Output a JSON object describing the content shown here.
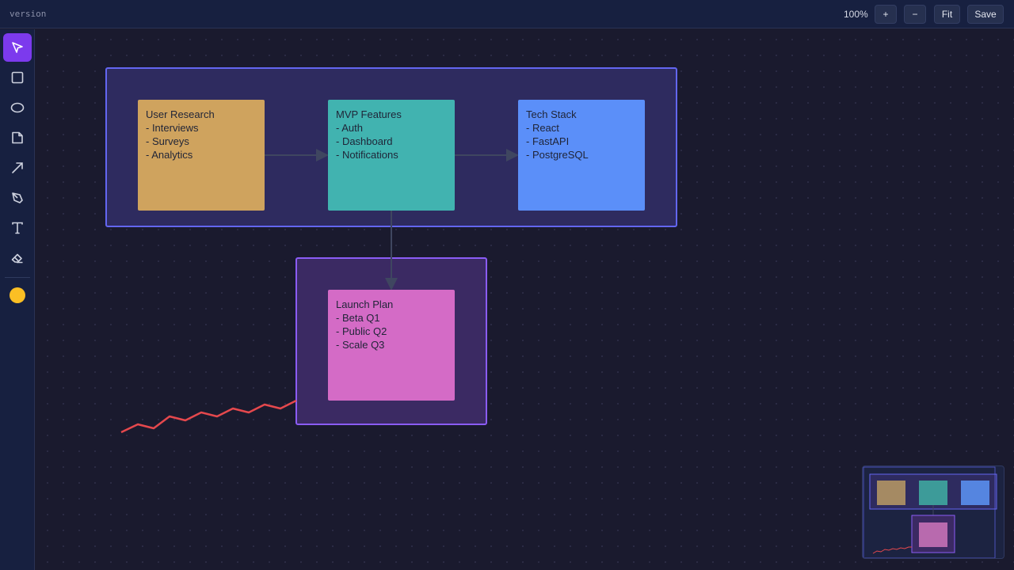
{
  "topbar": {
    "title": "version",
    "zoom": "100%",
    "zoom_in_label": "+",
    "zoom_out_label": "−",
    "fit_label": "Fit",
    "save_label": "Save"
  },
  "tools": [
    {
      "name": "select-tool",
      "icon": "cursor-icon",
      "active": true
    },
    {
      "name": "rectangle-tool",
      "icon": "square-icon",
      "active": false
    },
    {
      "name": "ellipse-tool",
      "icon": "ellipse-icon",
      "active": false
    },
    {
      "name": "sticky-note-tool",
      "icon": "note-icon",
      "active": false
    },
    {
      "name": "arrow-tool",
      "icon": "arrow-icon",
      "active": false
    },
    {
      "name": "pen-tool",
      "icon": "pen-icon",
      "active": false
    },
    {
      "name": "text-tool",
      "icon": "text-icon",
      "active": false
    },
    {
      "name": "eraser-tool",
      "icon": "eraser-icon",
      "active": false
    }
  ],
  "color_swatch": "#fbbf24",
  "colors": {
    "accent": "#7c3aed",
    "frame_top_fill": "#2e2b5f",
    "frame_top_border": "#6366f1",
    "frame_bottom_fill": "#3b2a63",
    "frame_bottom_border": "#8b5cf6",
    "connector": "#3f4660",
    "freehand": "#e5484d"
  },
  "notes": {
    "user_research": {
      "color": "#cfa35e",
      "lines": [
        "User Research",
        "- Interviews",
        "- Surveys",
        "- Analytics"
      ]
    },
    "mvp_features": {
      "color": "#41b3b0",
      "lines": [
        "MVP Features",
        "- Auth",
        "- Dashboard",
        "- Notifications"
      ]
    },
    "tech_stack": {
      "color": "#5b8ff9",
      "lines": [
        "Tech Stack",
        "- React",
        "- FastAPI",
        "- PostgreSQL"
      ]
    },
    "launch_plan": {
      "color": "#d46bc6",
      "lines": [
        "Launch Plan",
        "- Beta Q1",
        "- Public Q2",
        "- Scale Q3"
      ]
    }
  }
}
